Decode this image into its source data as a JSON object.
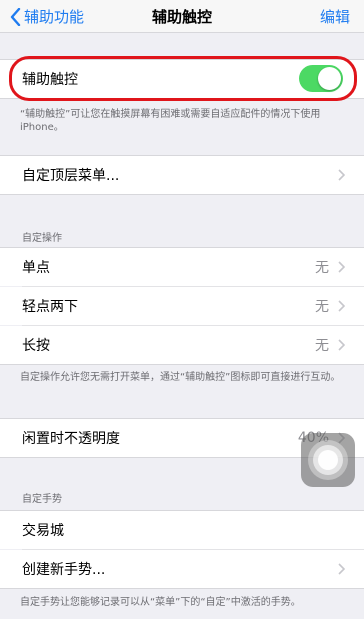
{
  "nav": {
    "back_label": "辅助功能",
    "title": "辅助触控",
    "edit_label": "编辑"
  },
  "assistive_touch": {
    "label": "辅助触控",
    "enabled": true,
    "accent_color": "#4cd964"
  },
  "assistive_footer": "“辅助触控”可让您在触摸屏幕有困难或需要自适应配件的情况下使用 iPhone。",
  "customize_menu": {
    "label": "自定顶层菜单..."
  },
  "custom_actions": {
    "header": "自定操作",
    "items": [
      {
        "label": "单点",
        "value": "无"
      },
      {
        "label": "轻点两下",
        "value": "无"
      },
      {
        "label": "长按",
        "value": "无"
      }
    ],
    "footer": "自定操作允许您无需打开菜单，通过“辅助触控”图标即可直接进行互动。"
  },
  "idle_opacity": {
    "label": "闲置时不透明度",
    "value": "40%"
  },
  "custom_gestures": {
    "header": "自定手势",
    "items": [
      {
        "label": "交易城"
      },
      {
        "label": "创建新手势..."
      }
    ],
    "footer": "自定手势让您能够记录可以从“菜单”下的“自定”中激活的手势。"
  },
  "colors": {
    "link": "#1f7cf0",
    "highlight": "#e0151b"
  }
}
